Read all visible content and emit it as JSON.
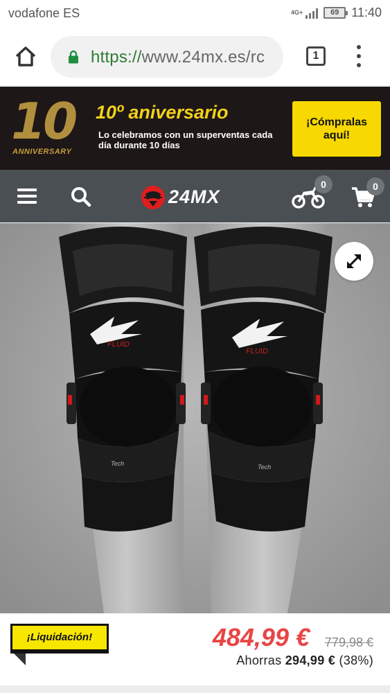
{
  "status_bar": {
    "carrier": "vodafone ES",
    "network": "4G+",
    "battery": "69",
    "time": "11:40"
  },
  "browser": {
    "url_scheme": "https://",
    "url_rest": "www.24mx.es/rс",
    "tab_count": "1"
  },
  "promo": {
    "logo_number": "10",
    "logo_caption": "ANNIVERSARY",
    "title": "10º aniversario",
    "subtitle": "Lo celebramos con un superventas cada día durante 10 días",
    "cta": "¡Cómpralas aquí!"
  },
  "nav": {
    "logo_text": "24MX",
    "garage_count": "0",
    "cart_count": "0"
  },
  "product": {
    "image_alt": "Alpinestars Fluid Tech knee braces",
    "brand_print": "FLUID",
    "tech_print": "Tech"
  },
  "price": {
    "tag": "¡Liquidación!",
    "current": "484,99 €",
    "old": "779,98 €",
    "savings_prefix": "Ahorras",
    "savings_amount": "294,99 €",
    "savings_percent": "(38%)"
  },
  "colors": {
    "promo_bg": "#1e1717",
    "promo_accent": "#f2d21a",
    "cta_bg": "#f7d800",
    "nav_bg": "#4a4f54",
    "price_red": "#e84545",
    "url_green": "#2e7d32"
  }
}
